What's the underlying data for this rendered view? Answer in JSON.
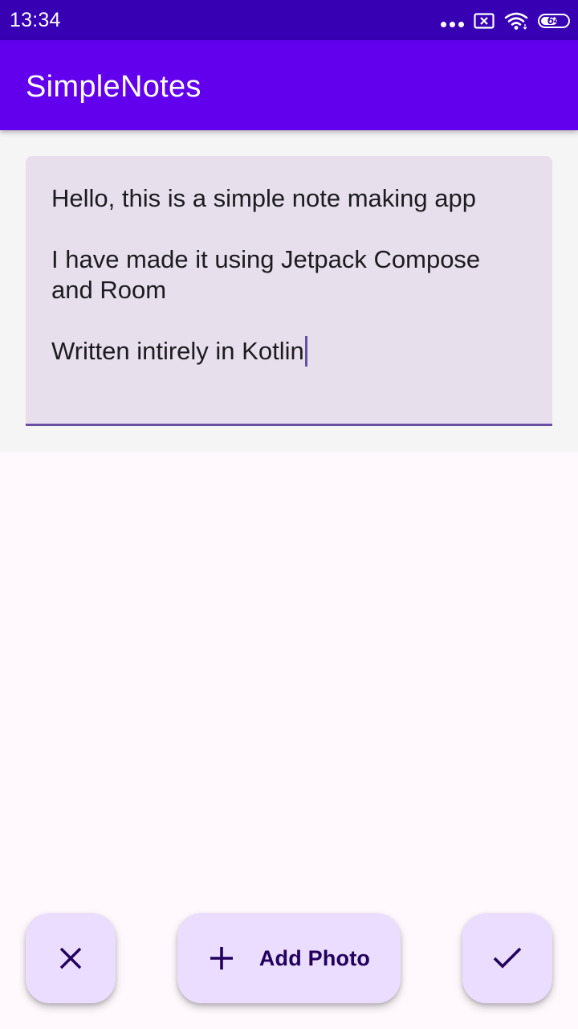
{
  "status_bar": {
    "time": "13:34",
    "battery_level": "64",
    "battery_fill_fraction": 0.64
  },
  "app_bar": {
    "title": "SimpleNotes"
  },
  "note": {
    "text": "Hello, this is a simple note making app\n\nI have made it using Jetpack Compose and Room\n\nWritten intirely in Kotlin"
  },
  "actions": {
    "cancel_icon": "close-icon",
    "add_photo_icon": "plus-icon",
    "add_photo_label": "Add Photo",
    "confirm_icon": "check-icon"
  },
  "colors": {
    "status_bar": "#3700B3",
    "app_bar": "#6200EE",
    "field_background": "#E7E0EC",
    "field_indicator": "#6750A4",
    "fab_background": "#EADDFF",
    "fab_content": "#21005D"
  }
}
